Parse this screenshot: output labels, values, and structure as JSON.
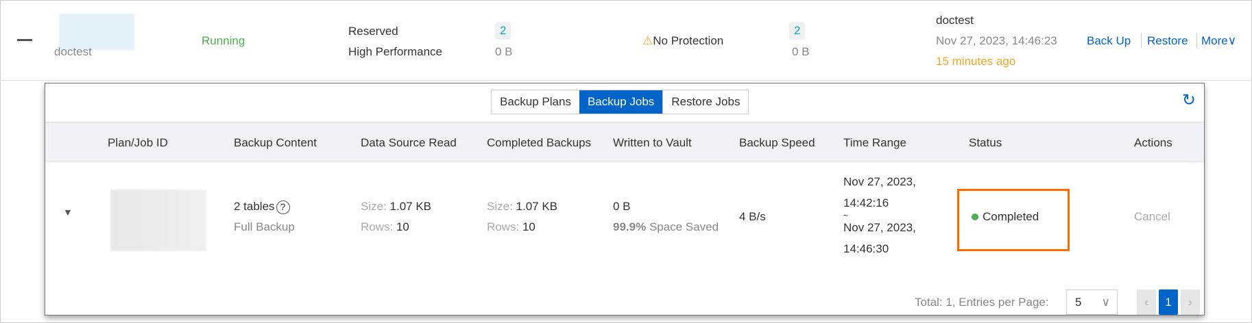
{
  "row": {
    "account": "doctest",
    "status": "Running",
    "storage_type_1": "Reserved",
    "storage_type_2": "High Performance",
    "count_1": "2",
    "size_1": "0 B",
    "protection": "No Protection",
    "count_2": "2",
    "size_2": "0 B",
    "last_user": "doctest",
    "last_time": "Nov 27, 2023, 14:46:23",
    "last_relative": "15 minutes ago",
    "actions": {
      "backup": "Back Up",
      "restore": "Restore",
      "more": "More"
    }
  },
  "panel": {
    "tabs": [
      {
        "label": "Backup Plans"
      },
      {
        "label": "Backup Jobs"
      },
      {
        "label": "Restore Jobs"
      }
    ],
    "active_tab": "Backup Jobs",
    "columns": [
      "Plan/Job ID",
      "Backup Content",
      "Data Source Read",
      "Completed Backups",
      "Written to Vault",
      "Backup Speed",
      "Time Range",
      "Status",
      "Actions"
    ],
    "job": {
      "content": "2 tables",
      "content_type": "Full Backup",
      "read_size_label": "Size:",
      "read_size": "1.07 KB",
      "read_rows_label": "Rows:",
      "read_rows": "10",
      "done_size_label": "Size:",
      "done_size": "1.07 KB",
      "done_rows_label": "Rows:",
      "done_rows": "10",
      "written": "0 B",
      "saved_pct": "99.9%",
      "saved_label": "Space Saved",
      "speed": "4 B/s",
      "start_date": "Nov 27, 2023,",
      "start_time": "14:42:16",
      "sep": "~",
      "end_date": "Nov 27, 2023,",
      "end_time": "14:46:30",
      "status": "Completed",
      "action": "Cancel"
    },
    "pagination": {
      "summary": "Total: 1, Entries per Page:",
      "page_size": "5",
      "current_page": "1"
    }
  },
  "colors": {
    "accent": "#0064c8",
    "running": "#4caf50",
    "warning": "#f5a623",
    "highlight": "#ff6a00"
  }
}
